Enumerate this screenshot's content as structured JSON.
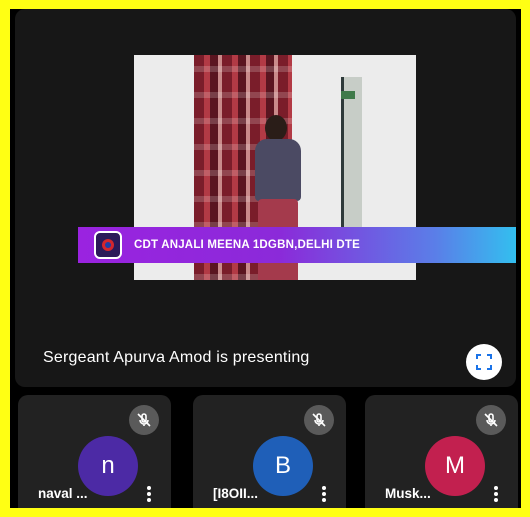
{
  "presenter_banner": {
    "name": "CDT ANJALI MEENA 1DGBN,DELHI DTE"
  },
  "presenting_status": "Sergeant Apurva Amod is presenting",
  "participants": [
    {
      "initial": "n",
      "name": "naval ...",
      "avatar_color": "#4c2aa5",
      "mic_icon": "mic-off-icon"
    },
    {
      "initial": "B",
      "name": "[I8OII...",
      "avatar_color": "#1f5fb8",
      "mic_icon": "mic-off-icon"
    },
    {
      "initial": "M",
      "name": "Musk...",
      "avatar_color": "#c2204f",
      "mic_icon": "mic-off-icon"
    }
  ],
  "colors": {
    "frame_border": "#ffff14",
    "banner_gradient_start": "#9a23e0",
    "banner_gradient_end": "#2ec7f0"
  },
  "icons": {
    "fullscreen": "fullscreen-icon",
    "more": "more-vert-icon",
    "banner_logo": "ncc-logo-icon"
  }
}
